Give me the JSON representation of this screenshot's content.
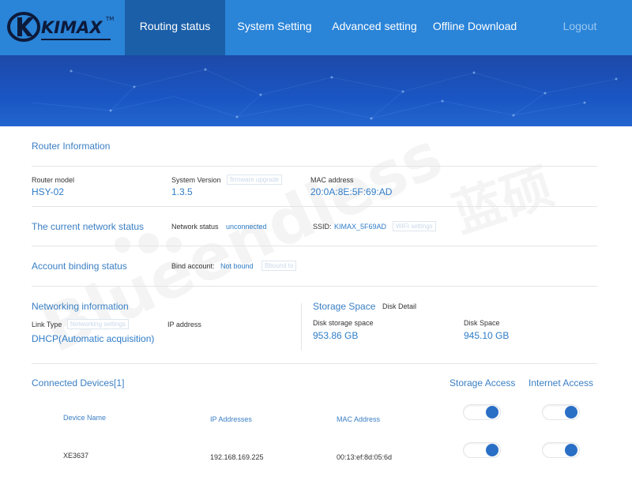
{
  "brand": {
    "name": "KIMAX",
    "tm": "TM"
  },
  "nav": {
    "routing_status": "Routing status",
    "system_setting": "System Setting",
    "advanced_setting": "Advanced setting",
    "offline_download": "Offline Download",
    "logout": "Logout"
  },
  "router_info": {
    "title": "Router Information",
    "model_label": "Router model",
    "model_value": "HSY-02",
    "version_label": "System Version",
    "version_value": "1.3.5",
    "firmware_btn": "firmware upgrade",
    "mac_label": "MAC address",
    "mac_value": "20:0A:8E:5F:69:AD"
  },
  "network_status": {
    "title": "The current network status",
    "status_label": "Network status",
    "status_value": "unconnected",
    "ssid_label": "SSID:",
    "ssid_value": "KIMAX_5F69AD",
    "wifi_btn": "WIFI settings"
  },
  "account": {
    "title": "Account binding status",
    "bind_label": "Bind account:",
    "bind_value": "Not bound",
    "bind_btn": "Bbound to"
  },
  "networking": {
    "title": "Networking information",
    "link_type_label": "Link Type",
    "networking_btn": "Networking settings",
    "ip_label": "IP address",
    "link_type_value": "DHCP(Automatic acquisition)"
  },
  "storage": {
    "title": "Storage Space",
    "disk_detail": "Disk Detail",
    "disk_storage_label": "Disk storage space",
    "disk_storage_value": "953.86 GB",
    "disk_space_label": "Disk Space",
    "disk_space_value": "945.10 GB"
  },
  "devices": {
    "title": "Connected Devices[1]",
    "storage_access": "Storage Access",
    "internet_access": "Internet Access",
    "columns": {
      "name": "Device Name",
      "ip": "IP Addresses",
      "mac": "MAC Address"
    },
    "rows": [
      {
        "name": "XE3637",
        "ip": "192.168.169.225",
        "mac": "00:13:ef:8d:05:6d"
      }
    ]
  },
  "watermark": {
    "latin": "Blueendless",
    "cjk": "蓝硕"
  },
  "colors": {
    "header": "#2a84d8",
    "active_tab": "#1b5fa8",
    "accent": "#2f7cc7",
    "toggle_on": "#2a6fc6"
  }
}
